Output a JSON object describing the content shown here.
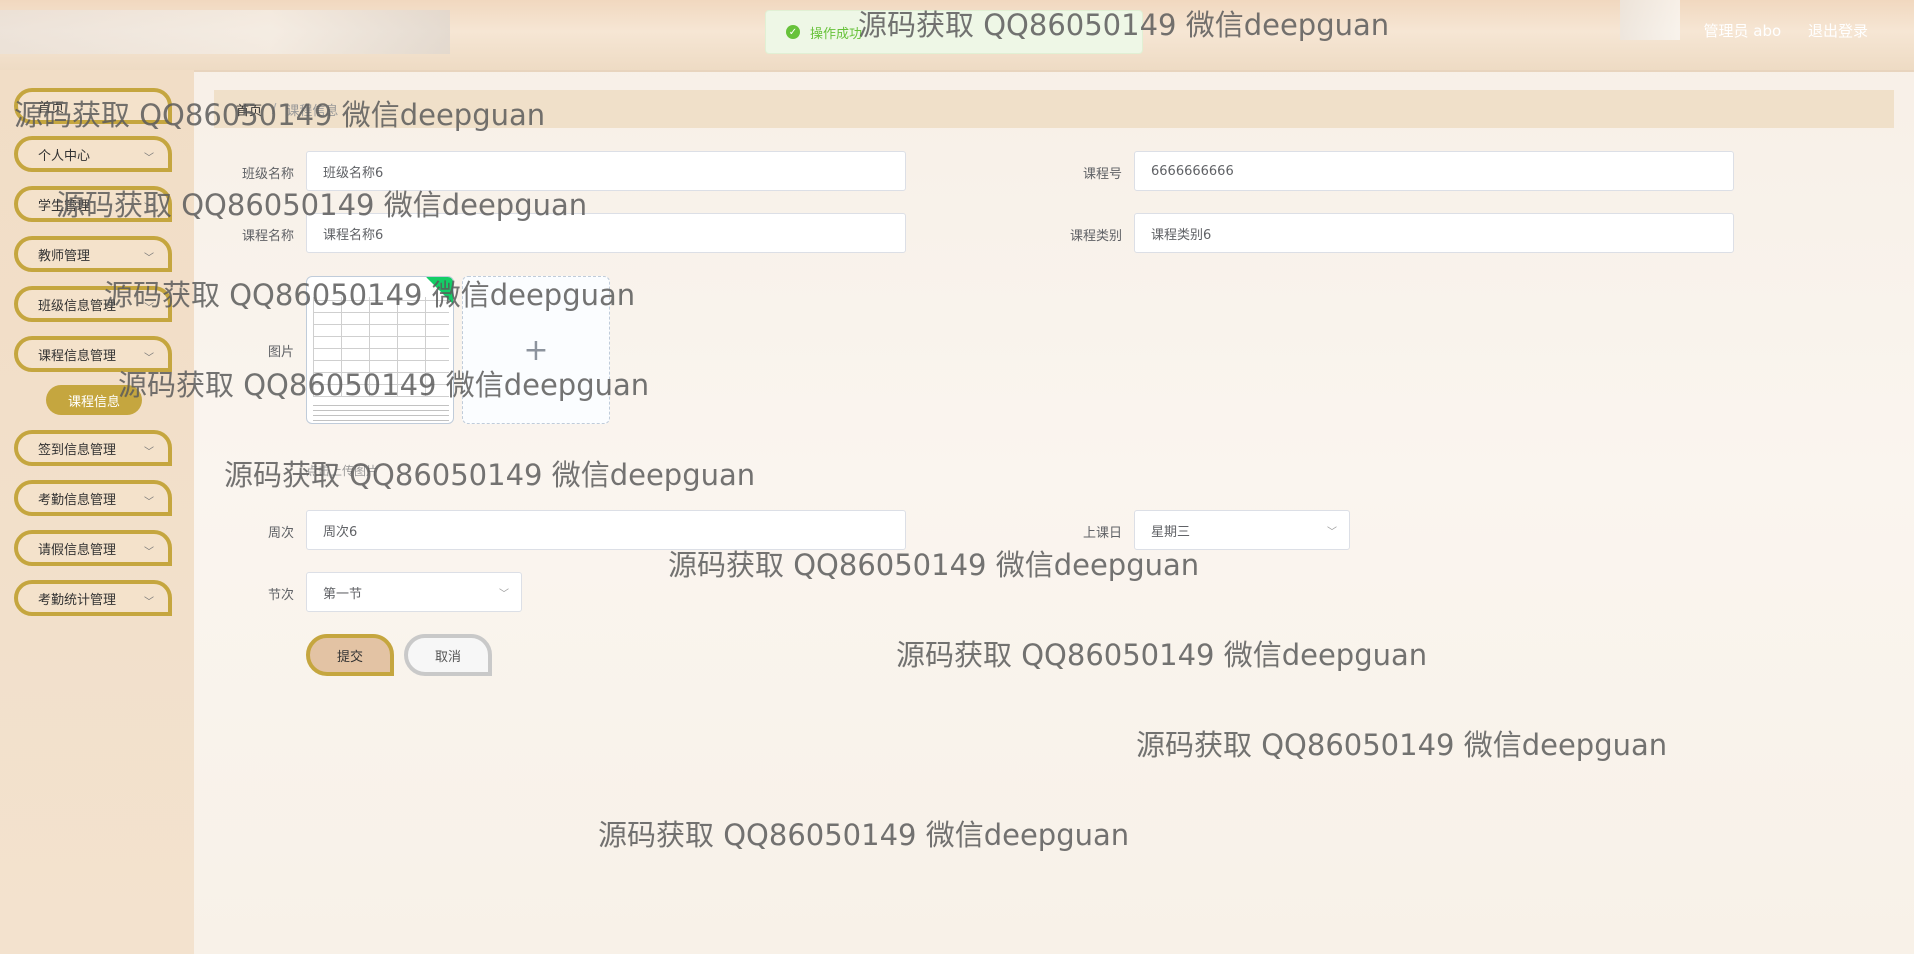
{
  "header": {
    "user_label": "管理员 abo",
    "logout_label": "退出登录"
  },
  "toast": {
    "message": "操作成功"
  },
  "sidebar": {
    "items": [
      {
        "label": "首页"
      },
      {
        "label": "个人中心"
      },
      {
        "label": "学生管理"
      },
      {
        "label": "教师管理"
      },
      {
        "label": "班级信息管理"
      },
      {
        "label": "课程信息管理"
      },
      {
        "label": "签到信息管理"
      },
      {
        "label": "考勤信息管理"
      },
      {
        "label": "请假信息管理"
      },
      {
        "label": "考勤统计管理"
      }
    ],
    "submenu_label": "课程信息"
  },
  "breadcrumb": {
    "home": "首页",
    "separator": "/",
    "current": "课程信息"
  },
  "form": {
    "class_name": {
      "label": "班级名称",
      "value": "班级名称6"
    },
    "course_no": {
      "label": "课程号",
      "value": "6666666666"
    },
    "course_name": {
      "label": "课程名称",
      "value": "课程名称6"
    },
    "course_type": {
      "label": "课程类别",
      "value": "课程类别6"
    },
    "picture": {
      "label": "图片",
      "upload_symbol": "+",
      "hint": "点击上传图片"
    },
    "week": {
      "label": "周次",
      "value": "周次6"
    },
    "weekday": {
      "label": "上课日",
      "value": "星期三"
    },
    "period": {
      "label": "节次",
      "value": "第一节"
    },
    "submit_label": "提交",
    "cancel_label": "取消"
  },
  "watermark": {
    "text": "源码获取 QQ86050149 微信deepguan"
  },
  "icons": {
    "success": "check-circle-icon",
    "chevron": "chevron-down-icon",
    "plus": "plus-icon"
  },
  "colors": {
    "accent": "#c5a63f",
    "success": "#67c23a",
    "header_text": "#ffffff"
  }
}
